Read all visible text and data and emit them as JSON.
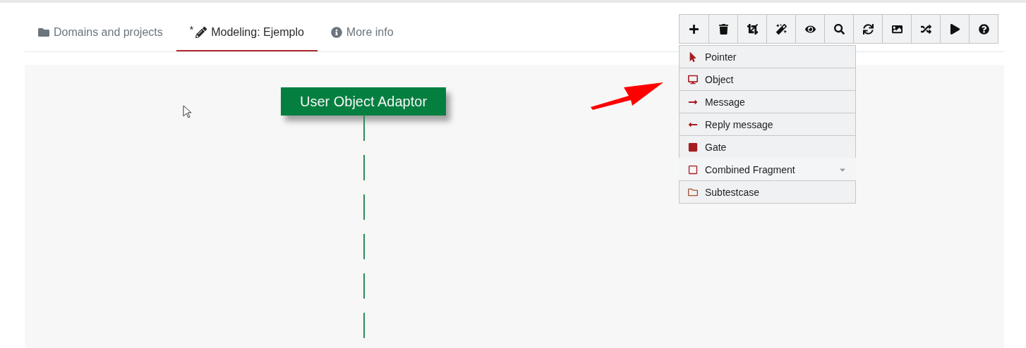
{
  "tabs": [
    {
      "label": "Domains and projects",
      "kind": "folder",
      "selected": false
    },
    {
      "label": "Modeling: Ejemplo",
      "kind": "pencil",
      "selected": true,
      "marker": "*"
    },
    {
      "label": "More info",
      "kind": "info",
      "selected": false
    }
  ],
  "toolbar": [
    {
      "kind": "add"
    },
    {
      "kind": "delete"
    },
    {
      "kind": "crop"
    },
    {
      "kind": "magic"
    },
    {
      "kind": "view"
    },
    {
      "kind": "search"
    },
    {
      "kind": "refresh"
    },
    {
      "kind": "image"
    },
    {
      "kind": "shuffle"
    },
    {
      "kind": "play"
    },
    {
      "kind": "help"
    }
  ],
  "palette": [
    {
      "label": "Pointer",
      "kind": "pointer",
      "selected": false
    },
    {
      "label": "Object",
      "kind": "object",
      "selected": false
    },
    {
      "label": "Message",
      "kind": "message",
      "selected": false
    },
    {
      "label": "Reply message",
      "kind": "reply",
      "selected": false
    },
    {
      "label": "Gate",
      "kind": "gate",
      "selected": false
    },
    {
      "label": "Combined Fragment",
      "kind": "fragment",
      "selected": true,
      "expandable": true
    },
    {
      "label": "Subtestcase",
      "kind": "subtestcase",
      "selected": false
    }
  ],
  "canvas": {
    "lifeline": {
      "label": "User Object Adaptor"
    }
  }
}
